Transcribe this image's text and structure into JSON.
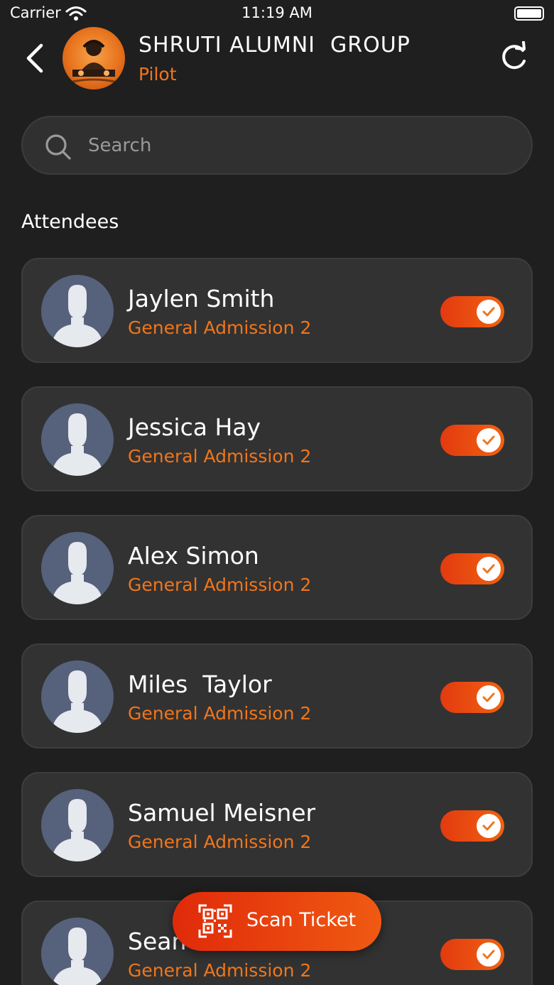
{
  "status_bar": {
    "carrier": "Carrier",
    "time": "11:19 AM"
  },
  "header": {
    "title": "SHRUTI ALUMNI  GROUP",
    "subtitle": "Pilot",
    "accent": "#f0761b"
  },
  "search": {
    "placeholder": "Search",
    "value": ""
  },
  "section": {
    "title": "Attendees"
  },
  "attendees": [
    {
      "name": "Jaylen Smith",
      "ticket": "General Admission 2",
      "checked_in": true
    },
    {
      "name": "Jessica Hay",
      "ticket": "General Admission 2",
      "checked_in": true
    },
    {
      "name": "Alex Simon",
      "ticket": "General Admission 2",
      "checked_in": true
    },
    {
      "name": "Miles  Taylor",
      "ticket": "General Admission 2",
      "checked_in": true
    },
    {
      "name": "Samuel Meisner",
      "ticket": "General Admission 2",
      "checked_in": true
    },
    {
      "name": "Sean",
      "ticket": "General Admission 2",
      "checked_in": true
    }
  ],
  "scan_button": {
    "label": "Scan Ticket",
    "icon": "qr-code-icon"
  },
  "icons": {
    "back": "chevron-left-icon",
    "refresh": "refresh-icon",
    "search": "search-icon",
    "avatar": "person-placeholder-icon",
    "check": "check-icon"
  }
}
